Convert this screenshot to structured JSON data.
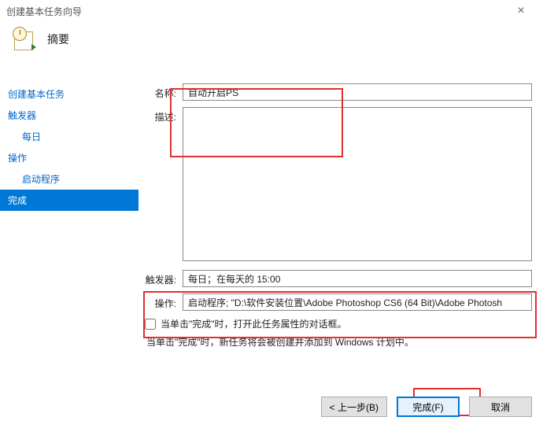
{
  "window": {
    "title": "创建基本任务向导"
  },
  "header": {
    "title": "摘要"
  },
  "nav": {
    "items": [
      {
        "label": "创建基本任务",
        "sub": false,
        "active": false
      },
      {
        "label": "触发器",
        "sub": false,
        "active": false
      },
      {
        "label": "每日",
        "sub": true,
        "active": false
      },
      {
        "label": "操作",
        "sub": false,
        "active": false
      },
      {
        "label": "启动程序",
        "sub": true,
        "active": false
      },
      {
        "label": "完成",
        "sub": false,
        "active": true
      }
    ]
  },
  "fields": {
    "name_label": "名称:",
    "name_value": "自动开启PS",
    "desc_label": "描述:",
    "desc_value": "",
    "trigger_label": "触发器:",
    "trigger_value": "每日；在每天的 15:00",
    "action_label": "操作:",
    "action_value": "启动程序; \"D:\\软件安装位置\\Adobe Photoshop CS6 (64 Bit)\\Adobe Photosh"
  },
  "options": {
    "open_props_label": "当单击\"完成\"时，打开此任务属性的对话框。",
    "note": "当单击\"完成\"时，新任务将会被创建并添加到 Windows 计划中。"
  },
  "footer": {
    "back": "< 上一步(B)",
    "finish": "完成(F)",
    "cancel": "取消"
  }
}
